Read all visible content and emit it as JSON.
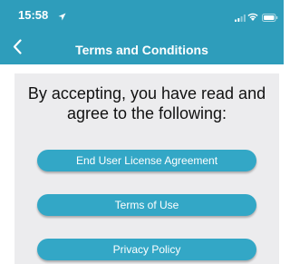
{
  "status_bar": {
    "time": "15:58",
    "icons": [
      "location-arrow-icon",
      "signal-icon",
      "wifi-icon",
      "battery-icon"
    ]
  },
  "nav": {
    "back_icon": "chevron-left-icon",
    "title": "Terms and Conditions"
  },
  "intro": {
    "line1": "By accepting, you have read and",
    "line2": "agree to the following:"
  },
  "buttons": [
    {
      "label": "End User License Agreement"
    },
    {
      "label": "Terms of Use"
    },
    {
      "label": "Privacy Policy"
    }
  ],
  "colors": {
    "header": "#2e9dbb",
    "button": "#33a7c6",
    "content_bg": "#ececee"
  }
}
